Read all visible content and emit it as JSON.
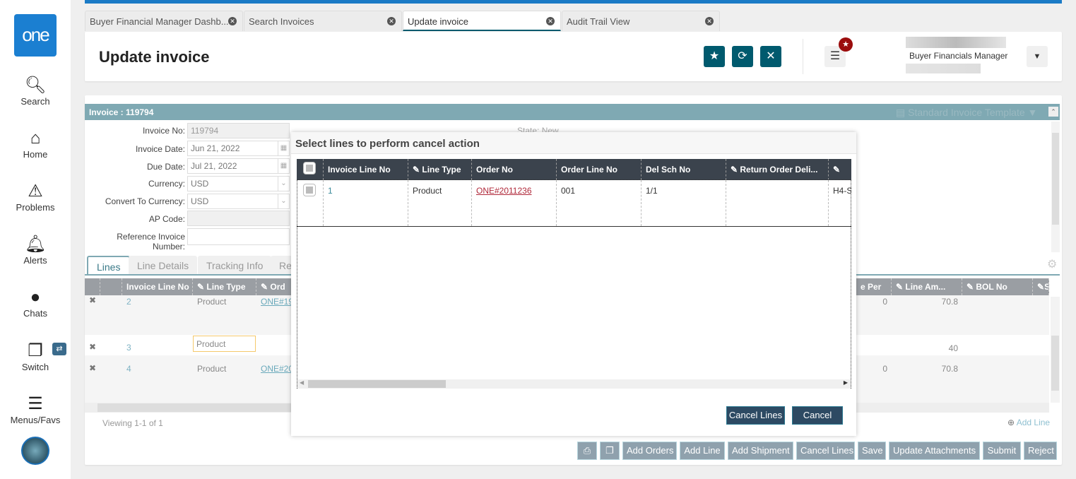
{
  "sidebar": {
    "logo": "one",
    "items": [
      {
        "label": "Search",
        "icon": "search-icon"
      },
      {
        "label": "Home",
        "icon": "home-icon"
      },
      {
        "label": "Problems",
        "icon": "warning-icon"
      },
      {
        "label": "Alerts",
        "icon": "bell-icon"
      },
      {
        "label": "Chats",
        "icon": "chat-icon"
      },
      {
        "label": "Switch",
        "icon": "switch-icon"
      },
      {
        "label": "Menus/Favs",
        "icon": "menu-icon"
      }
    ]
  },
  "tabs": [
    {
      "label": "Buyer Financial Manager Dashb..."
    },
    {
      "label": "Search Invoices"
    },
    {
      "label": "Update invoice",
      "active": true
    },
    {
      "label": "Audit Trail View"
    }
  ],
  "header": {
    "title": "Update invoice",
    "user_role": "Buyer Financials Manager"
  },
  "invoice": {
    "title": "Invoice : 119794",
    "template": "Standard Invoice Template",
    "state_label": "State:",
    "state_value": "New",
    "fields": [
      {
        "label": "Invoice No:",
        "value": "119794"
      },
      {
        "label": "Invoice Date:",
        "value": "Jun 21, 2022"
      },
      {
        "label": "Due Date:",
        "value": "Jul 21, 2022"
      },
      {
        "label": "Currency:",
        "value": "USD"
      },
      {
        "label": "Convert To Currency:",
        "value": "USD"
      },
      {
        "label": "AP Code:",
        "value": ""
      },
      {
        "label": "Reference Invoice Number:",
        "value": ""
      }
    ]
  },
  "line_tabs": [
    "Lines",
    "Line Details",
    "Tracking Info",
    "Re"
  ],
  "grid": {
    "headers": [
      "Invoice Line No",
      "Line Type",
      "Ord",
      "e Per",
      "Line Am...",
      "BOL No",
      "SA"
    ],
    "rows": [
      {
        "line": "2",
        "type": "Product",
        "order": "ONE#19",
        "per": "0",
        "amount": "70.8"
      },
      {
        "line": "3",
        "type": "Product",
        "order": "",
        "per": "",
        "amount": "40"
      },
      {
        "line": "4",
        "type": "Product",
        "order": "ONE#20",
        "per": "0",
        "amount": "70.8"
      }
    ],
    "viewing": "Viewing 1-1 of 1",
    "add_line": "Add Line"
  },
  "actions": [
    "Add Orders",
    "Add Line",
    "Add Shipment",
    "Cancel Lines",
    "Save",
    "Update Attachments",
    "Submit",
    "Reject"
  ],
  "modal": {
    "title": "Select lines to perform cancel action",
    "headers": [
      "Invoice Line No",
      "Line Type",
      "Order No",
      "Order Line No",
      "Del Sch No",
      "Return Order Deli...",
      ""
    ],
    "rows": [
      {
        "line": "1",
        "type": "Product",
        "order": "ONE#2011236",
        "order_line": "001",
        "del_sch": "1/1",
        "return": "",
        "last": "H4-S"
      }
    ],
    "confirm": "Cancel Lines",
    "cancel": "Cancel"
  },
  "colors": {
    "accent": "#005a6e",
    "brand": "#1b7fd1",
    "link_red": "#b0293a"
  }
}
